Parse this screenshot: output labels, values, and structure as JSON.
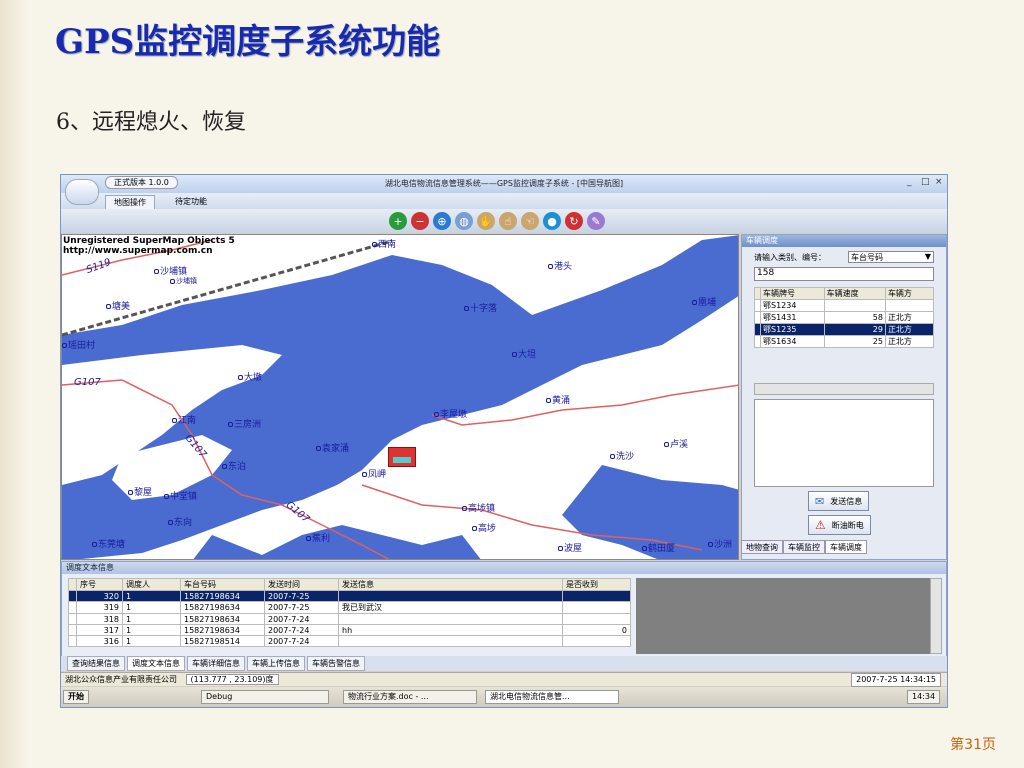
{
  "slide": {
    "title": "GPS监控调度子系统功能",
    "subtitle": "6、远程熄火、恢复",
    "page": "第31页"
  },
  "app": {
    "version_label": "正式版本 1.0.0",
    "window_title": "湖北电信物流信息管理系统——GPS监控调度子系统 - [中国导航图]",
    "tabs": [
      "地图操作",
      "待定功能"
    ],
    "win_controls": [
      "_",
      "□",
      "×"
    ]
  },
  "map": {
    "watermark_line1": "Unregistered SuperMap Objects 5",
    "watermark_line2": "http://www.supermap.com.cn",
    "places": [
      "西南",
      "沙埔镇",
      "沙埔镇",
      "塘美",
      "瑶田村",
      "港头",
      "十字落",
      "凰埔",
      "大坦",
      "大墩",
      "黄涌",
      "李屋墩",
      "江南",
      "三房洲",
      "袁家涌",
      "卢溪",
      "洗沙",
      "东泊",
      "凤岬",
      "黎屋",
      "中堂镇",
      "高埗镇",
      "东向",
      "高埗",
      "东莞塘",
      "蕉利",
      "波屋",
      "鹤田厦",
      "沙洲"
    ],
    "roads": [
      "S119",
      "G107",
      "G107",
      "G107"
    ]
  },
  "vehicle_panel": {
    "title": "车辆调度",
    "prompt": "请输入类别、编号：",
    "type_select": "车台号码",
    "input_value": "158",
    "columns": [
      "车辆牌号",
      "车辆速度",
      "车辆方"
    ],
    "rows": [
      [
        "鄂S1234",
        "",
        ""
      ],
      [
        "鄂S1431",
        "58",
        "正北方"
      ],
      [
        "鄂S1235",
        "29",
        "正北方"
      ],
      [
        "鄂S1634",
        "25",
        "正北方"
      ]
    ],
    "send_button": "发送信息",
    "cut_button": "断油断电",
    "tabs": [
      "地物查询",
      "车辆监控",
      "车辆调度"
    ]
  },
  "dispatch": {
    "title": "调度文本信息",
    "columns": [
      "序号",
      "调度人",
      "车台号码",
      "发送时间",
      "发送信息",
      "是否收到"
    ],
    "rows": [
      [
        "320",
        "1",
        "15827198634",
        "2007-7-25",
        "",
        ""
      ],
      [
        "319",
        "1",
        "15827198634",
        "2007-7-25",
        "我已到武汉",
        ""
      ],
      [
        "318",
        "1",
        "15827198634",
        "2007-7-24",
        "",
        ""
      ],
      [
        "317",
        "1",
        "15827198634",
        "2007-7-24",
        "hh",
        "0"
      ],
      [
        "316",
        "1",
        "15827198514",
        "2007-7-24",
        "",
        ""
      ]
    ],
    "tabs": [
      "查询结果信息",
      "调度文本信息",
      "车辆详细信息",
      "车辆上传信息",
      "车辆告警信息"
    ]
  },
  "status": {
    "company": "湖北公众信息产业有限责任公司",
    "coords": "(113.777 , 23.109)度",
    "datetime": "2007-7-25 14:34:15"
  },
  "taskbar": {
    "start": "开始",
    "items": [
      "Debug",
      "物流行业方案.doc - ...",
      "湖北电信物流信息管..."
    ],
    "clock": "14:34"
  }
}
